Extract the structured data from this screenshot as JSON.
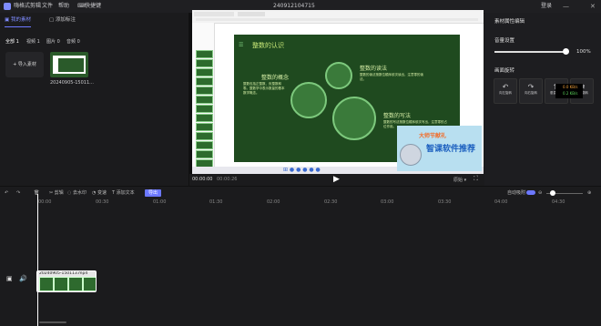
{
  "app": {
    "name": "嗨格式剪辑",
    "menu": [
      "文件",
      "帮助"
    ],
    "shortcut_label": "快捷键",
    "window_title": "240912104715",
    "login_label": "登录"
  },
  "left": {
    "tabs": [
      {
        "label": "我的素材"
      },
      {
        "label": "添加标注"
      }
    ],
    "filters": [
      "全部 1",
      "视频 1",
      "图片 0",
      "音频 0"
    ],
    "import_label": "导入素材",
    "media": [
      {
        "name": "20240905-15011..."
      }
    ]
  },
  "preview": {
    "slide": {
      "title": "整数的认识",
      "concept_title": "整数的概念",
      "concept_text": "整数包括正整数、负整数和零。整数学中表示数量的基本数学概念。",
      "read_title": "整数的读法",
      "read_text": "整数的读法按数位顺序依次读出，注意零的读法。",
      "write_title": "整数的写法",
      "write_text": "整数的写法按数位顺序依次写出，注意零的占位作用。"
    },
    "ad": {
      "top": "大师节献礼",
      "main": "智课软件推荐"
    },
    "time_current": "00:00:00",
    "time_total": "00:00:26",
    "ratio_label": "原始"
  },
  "right": {
    "title": "素材属性编辑",
    "volume_label": "音量设置",
    "volume_value": "100%",
    "volume_level": 1.0,
    "rotate_label": "画面旋转",
    "rotate_buttons": [
      "向左旋转",
      "向右旋转",
      "垂直翻转",
      "水平翻转"
    ],
    "net_up": "0.0 KB/s",
    "net_down": "0.2 KB/s"
  },
  "timeline": {
    "tools": [
      "剪辑",
      "去水印",
      "变速",
      "添加文本"
    ],
    "export_label": "导出",
    "auto_snap_label": "自动吸附",
    "ruler": [
      "00:00",
      "00:30",
      "01:00",
      "01:30",
      "02:00",
      "02:30",
      "03:00",
      "03:30",
      "04:00",
      "04:30"
    ],
    "clip_name": "20240905-150113.mp4"
  }
}
